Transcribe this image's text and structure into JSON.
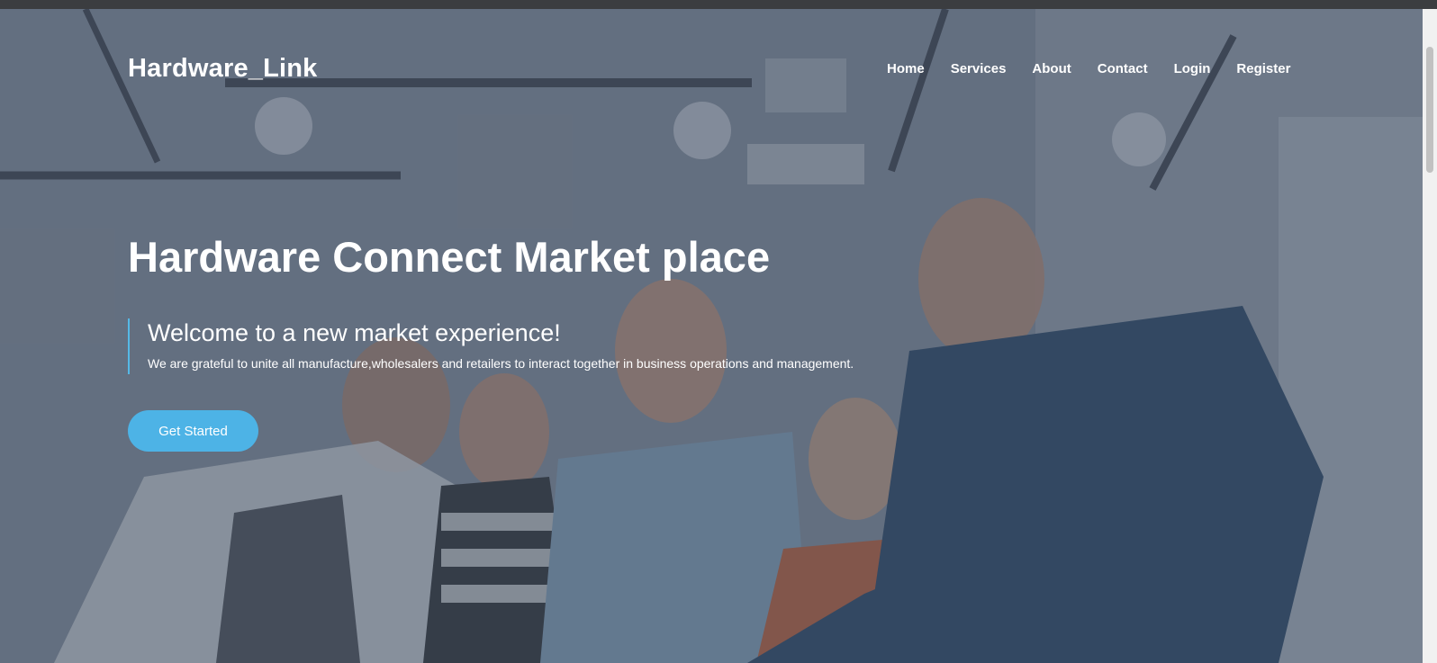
{
  "brand": {
    "name": "Hardware_Link"
  },
  "nav": {
    "items": [
      {
        "label": "Home"
      },
      {
        "label": "Services"
      },
      {
        "label": "About"
      },
      {
        "label": "Contact"
      },
      {
        "label": "Login"
      },
      {
        "label": "Register"
      }
    ]
  },
  "hero": {
    "headline": "Hardware Connect Market place",
    "welcome": "Welcome to a new market experience!",
    "tagline": "We are grateful to unite all manufacture,wholesalers and retailers to interact together in business operations and management.",
    "cta_label": "Get Started",
    "background_image": "team-meeting-photo"
  },
  "colors": {
    "accent": "#4db3e6",
    "overlay": "#3e4a5c",
    "text": "#ffffff"
  }
}
